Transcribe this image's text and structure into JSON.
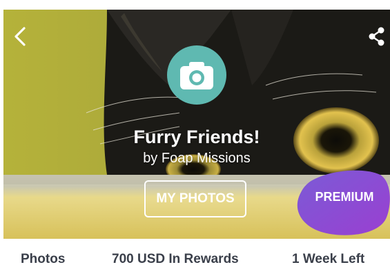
{
  "header": {
    "back_icon": "chevron-left-icon",
    "share_icon": "share-icon"
  },
  "mission": {
    "badge_icon": "camera-icon",
    "title": "Furry Friends!",
    "subtitle": "by Foap Missions",
    "my_photos_label": "MY PHOTOS",
    "premium_label": "PREMIUM"
  },
  "stats": {
    "photos": "Photos",
    "rewards": "700 USD In Rewards",
    "time_left": "1 Week Left"
  },
  "colors": {
    "badge_teal": "#5fb9b1",
    "premium_purple": "#8a4fd8",
    "stat_text": "#3a3f4a"
  }
}
